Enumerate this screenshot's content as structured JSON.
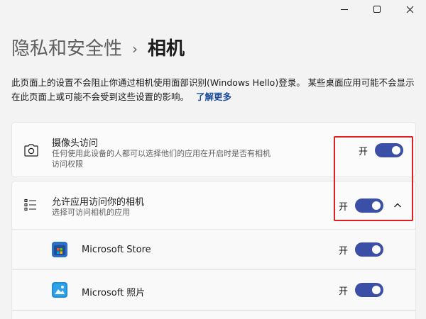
{
  "header": {
    "breadcrumb_parent": "隐私和安全性",
    "breadcrumb_separator": "›",
    "page_title": "相机"
  },
  "description": {
    "text": "此页面上的设置不会阻止你通过相机使用面部识别(Windows Hello)登录。 某些桌面应用可能不会显示在此页面上或可能不会受到这些设置的影响。",
    "link": "了解更多"
  },
  "camera_access": {
    "title": "摄像头访问",
    "subtitle_line1": "任何使用此设备的人都可以选择他们的应用在开启时是否有相机",
    "subtitle_line2": "访问权限",
    "toggle_label": "开",
    "state": "on"
  },
  "app_access": {
    "title": "允许应用访问你的相机",
    "subtitle": "选择可访问相机的应用",
    "toggle_label": "开",
    "state": "on",
    "expanded": true
  },
  "apps": [
    {
      "name": "Microsoft Store",
      "toggle_label": "开",
      "state": "on",
      "icon": "store-icon"
    },
    {
      "name": "Microsoft 照片",
      "toggle_label": "开",
      "state": "on",
      "icon": "photos-icon"
    }
  ],
  "colors": {
    "accent": "#3b4fa6",
    "highlight": "#e02020",
    "link": "#1a4b9c"
  }
}
